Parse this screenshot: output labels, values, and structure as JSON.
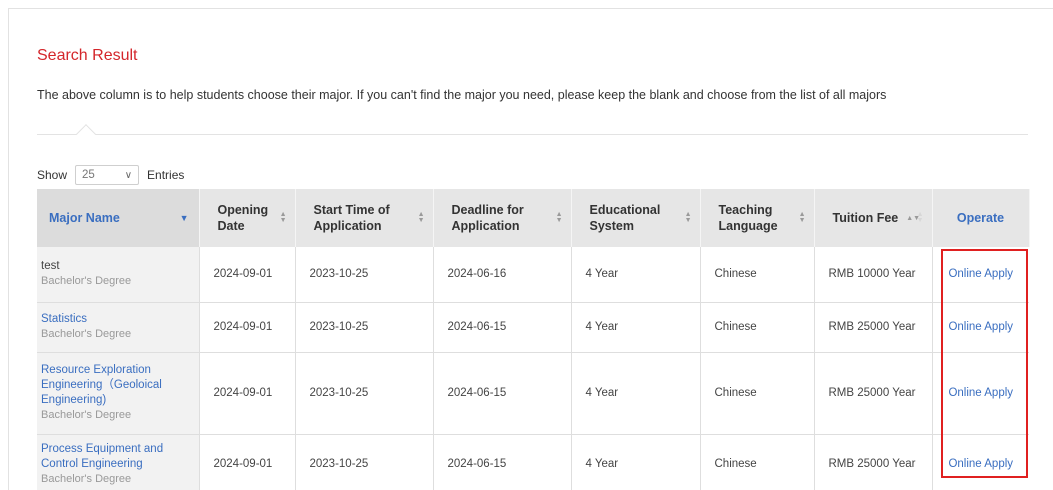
{
  "section": {
    "title": "Search Result",
    "description": "The above column is to help students choose their major. If you can't find the major you need, please keep the blank and choose from the list of all majors"
  },
  "length_control": {
    "show_label": "Show",
    "selected": "25",
    "entries_label": "Entries"
  },
  "table": {
    "headers": [
      "Major Name",
      "Opening Date",
      "Start Time of Application",
      "Deadline for Application",
      "Educational System",
      "Teaching Language",
      "Tuition Fee",
      "Operate"
    ],
    "rows": [
      {
        "major": "test",
        "degree": "Bachelor's Degree",
        "opening": "2024-09-01",
        "start": "2023-10-25",
        "deadline": "2024-06-16",
        "system": "4 Year",
        "language": "Chinese",
        "fee": "RMB 10000 Year",
        "action": "Online Apply"
      },
      {
        "major": "Statistics",
        "degree": "Bachelor's Degree",
        "opening": "2024-09-01",
        "start": "2023-10-25",
        "deadline": "2024-06-15",
        "system": "4 Year",
        "language": "Chinese",
        "fee": "RMB 25000 Year",
        "action": "Online Apply"
      },
      {
        "major": "Resource Exploration Engineering（Geoloical Engineering)",
        "degree": "Bachelor's Degree",
        "opening": "2024-09-01",
        "start": "2023-10-25",
        "deadline": "2024-06-15",
        "system": "4 Year",
        "language": "Chinese",
        "fee": "RMB 25000 Year",
        "action": "Online Apply"
      },
      {
        "major": "Process Equipment and Control Engineering",
        "degree": "Bachelor's Degree",
        "opening": "2024-09-01",
        "start": "2023-10-25",
        "deadline": "2024-06-15",
        "system": "4 Year",
        "language": "Chinese",
        "fee": "RMB 25000 Year",
        "action": "Online Apply"
      }
    ]
  },
  "colors": {
    "title_red": "#d4262b",
    "link_blue": "#3a6ec0",
    "highlight_red": "#e02020",
    "header_gray": "#e6e6e6"
  }
}
